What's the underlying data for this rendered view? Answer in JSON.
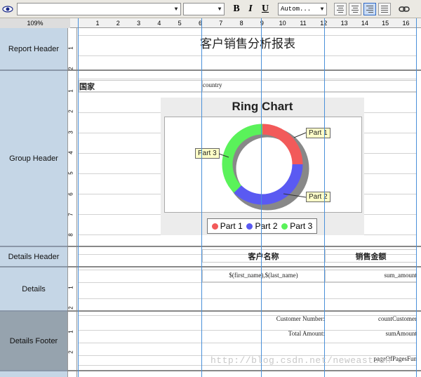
{
  "toolbar": {
    "eye_icon": "eye-icon",
    "font_select": "",
    "size_select": "",
    "bold": "B",
    "italic": "I",
    "underline": "U",
    "color_select": "Autom...",
    "link_icon": "link-icon"
  },
  "ruler": {
    "zoom": "109%",
    "ticks": [
      "1",
      "2",
      "3",
      "4",
      "5",
      "6",
      "7",
      "8",
      "9",
      "10",
      "11",
      "12",
      "13",
      "14",
      "15",
      "16"
    ]
  },
  "bands": [
    {
      "label": "Report Header",
      "ruler": [
        "1",
        "2"
      ]
    },
    {
      "label": "Group Header",
      "ruler": [
        "1",
        "2",
        "3",
        "4",
        "5",
        "6",
        "7",
        "8"
      ]
    },
    {
      "label": "Details Header",
      "ruler": []
    },
    {
      "label": "Details",
      "ruler": [
        "1",
        "2"
      ]
    },
    {
      "label": "Details Footer",
      "ruler": [
        "1",
        "2"
      ]
    }
  ],
  "report_header": {
    "title": "客户销售分析报表"
  },
  "group_header": {
    "country_label": "国家",
    "country_field": "country",
    "chart": {
      "title": "Ring Chart",
      "legend": [
        "Part 1",
        "Part 2",
        "Part 3"
      ],
      "callouts": [
        "Part 1",
        "Part 2",
        "Part 3"
      ],
      "colors": {
        "part1": "#f25a5a",
        "part2": "#5a5af2",
        "part3": "#5af25a"
      }
    }
  },
  "details_header": {
    "customer_name": "客户名称",
    "sales_amount": "销售金额"
  },
  "details": {
    "name_field": "$(first_name),$(last_name)",
    "amount_field": "sum_amount"
  },
  "details_footer": {
    "customer_number_label": "Customer Number:",
    "customer_number_field": "countCustomer",
    "total_amount_label": "Total Amount:",
    "total_amount_field": "sumAmount",
    "pages_field": "pageOfPagesFun"
  },
  "watermark": "http://blog.csdn.net/neweastsun"
}
